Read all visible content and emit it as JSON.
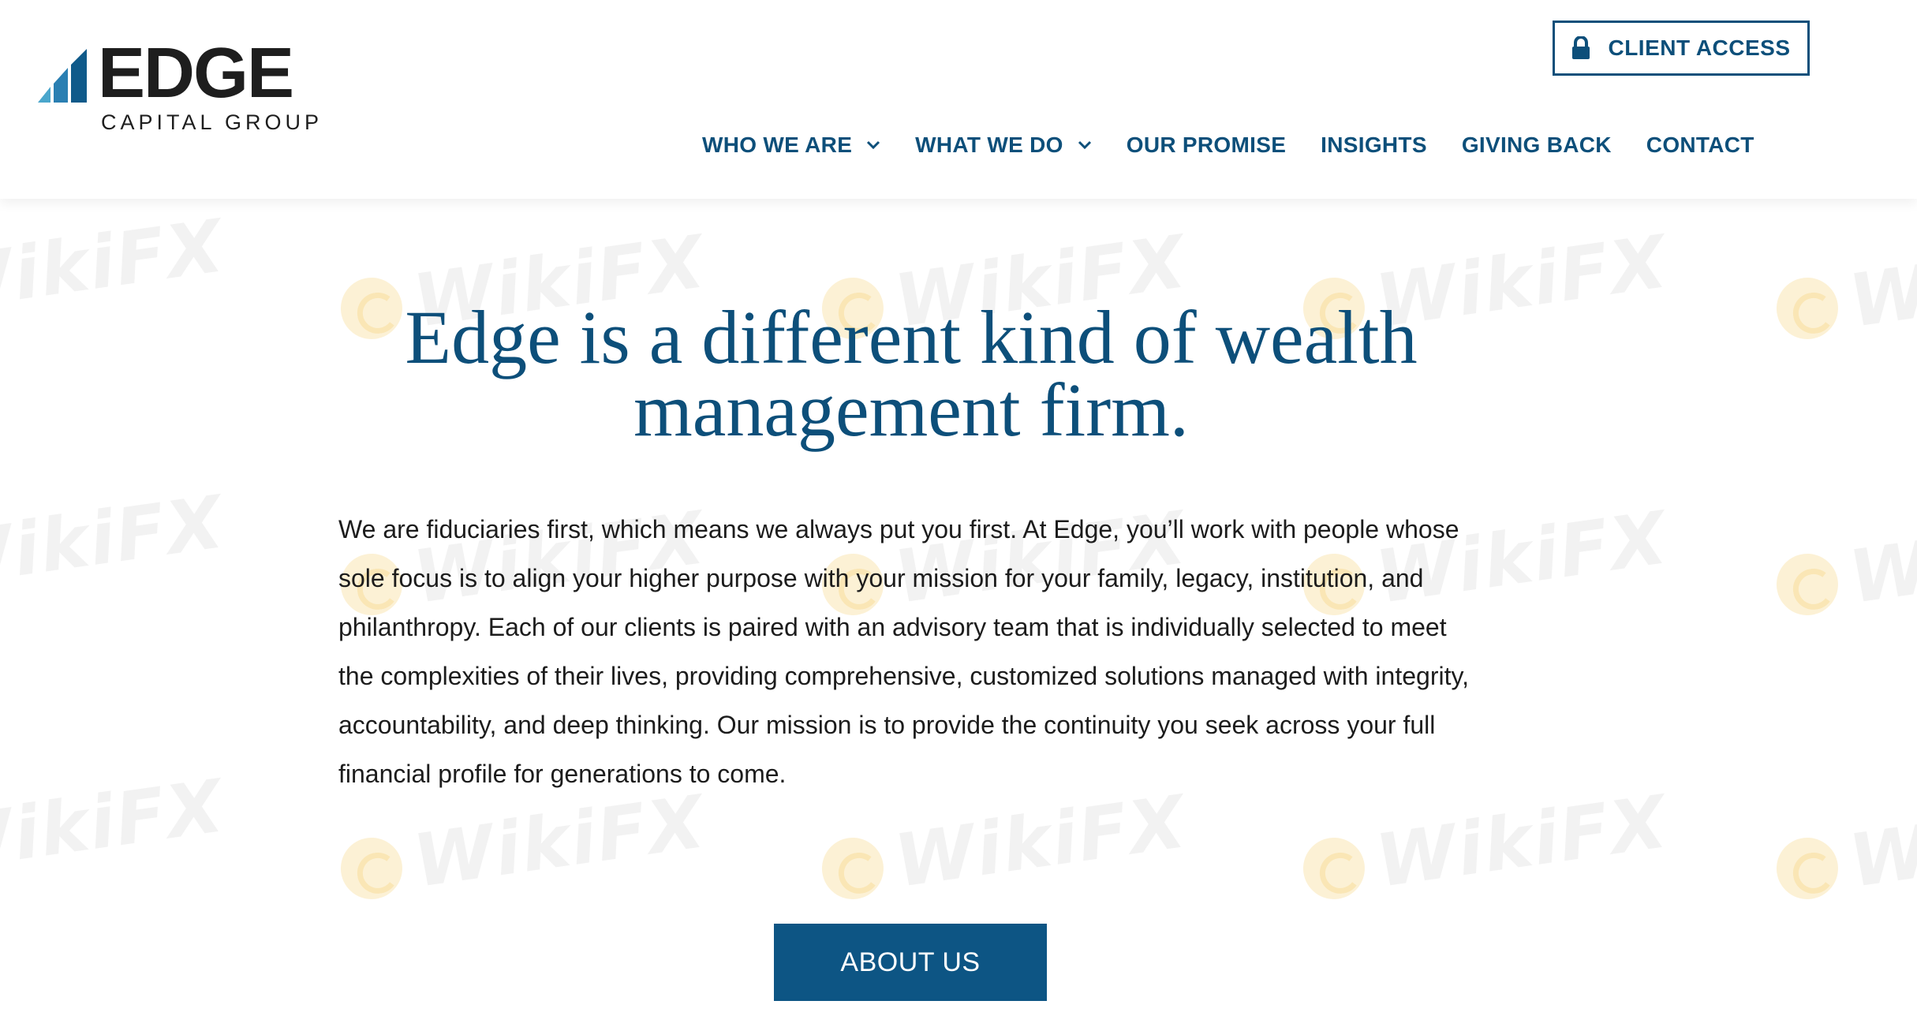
{
  "brand": {
    "name": "EDGE",
    "tagline": "CAPITAL GROUP",
    "bar_colors": [
      "#4aa6cc",
      "#2a7fb2",
      "#0f5a8a"
    ],
    "text_color": "#1e1e1e"
  },
  "header": {
    "client_access": {
      "label": "CLIENT ACCESS",
      "icon": "lock-icon"
    },
    "nav": [
      {
        "label": "WHO WE ARE",
        "has_dropdown": true
      },
      {
        "label": "WHAT WE DO",
        "has_dropdown": true
      },
      {
        "label": "OUR PROMISE",
        "has_dropdown": false
      },
      {
        "label": "INSIGHTS",
        "has_dropdown": false
      },
      {
        "label": "GIVING BACK",
        "has_dropdown": false
      },
      {
        "label": "CONTACT",
        "has_dropdown": false
      }
    ]
  },
  "hero": {
    "headline_line1": "Edge is a different kind of wealth",
    "headline_line2": "management firm.",
    "body": "We are fiduciaries first, which means we always put you first. At Edge, you’ll work with people whose sole focus is to align your higher purpose with your mission for your family, legacy, institution, and philanthropy. Each of our clients is paired with an advisory team that is individually selected to meet the complexities of their lives, providing comprehensive, customized solutions managed with integrity, accountability, and deep thinking. Our mission is to provide the continuity you seek across your full financial profile for generations to come.",
    "cta_label": "ABOUT US"
  },
  "watermark": {
    "text": "WikiFX"
  },
  "colors": {
    "primary": "#0d4f7a",
    "button_bg": "#0d5584",
    "body_text": "#1c1c1c"
  }
}
